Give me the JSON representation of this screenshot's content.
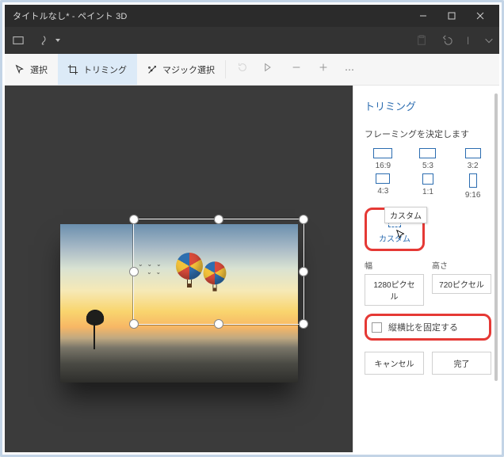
{
  "window": {
    "title": "タイトルなし* - ペイント 3D"
  },
  "toolbar": {
    "select": "選択",
    "trimming": "トリミング",
    "magic": "マジック選択"
  },
  "side": {
    "title": "トリミング",
    "framing_label": "フレーミングを決定します",
    "ratios": [
      {
        "cls": "w169",
        "label": "16:9"
      },
      {
        "cls": "w53",
        "label": "5:3"
      },
      {
        "cls": "w32",
        "label": "3:2"
      },
      {
        "cls": "w43",
        "label": "4:3"
      },
      {
        "cls": "w11",
        "label": "1:1"
      },
      {
        "cls": "w916",
        "label": "9:16"
      }
    ],
    "custom_label": "カスタム",
    "custom_tooltip": "カスタム",
    "width_label": "幅",
    "height_label": "高さ",
    "width_value": "1280ピクセル",
    "height_value": "720ピクセル",
    "lock_ratio": "縦横比を固定する",
    "cancel": "キャンセル",
    "done": "完了"
  }
}
